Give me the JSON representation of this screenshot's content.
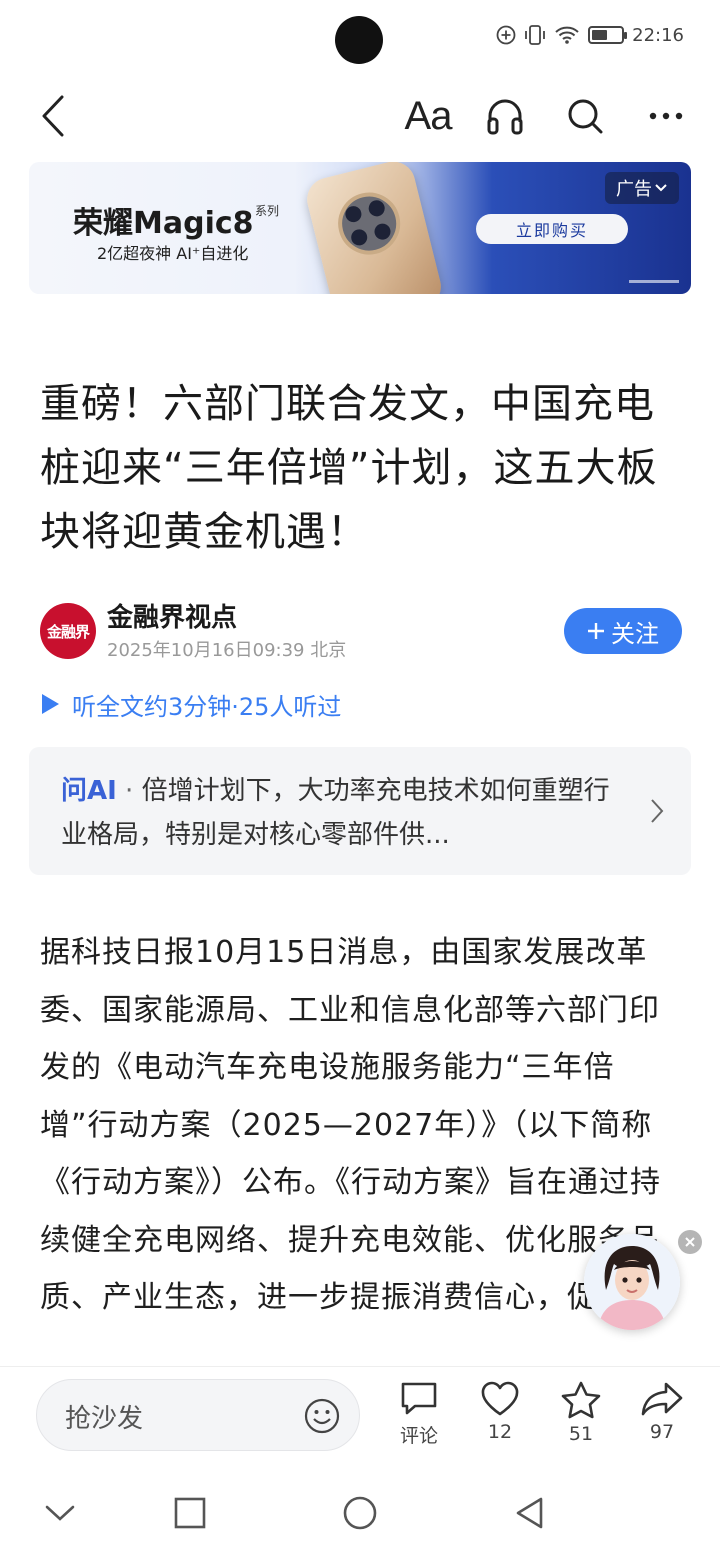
{
  "status_bar": {
    "time": "22:16",
    "battery_level_percent": 45,
    "icons": [
      "add-circle-icon",
      "vibrate-icon",
      "wifi-icon",
      "battery-icon"
    ]
  },
  "toolbar": {
    "font_label": "Aa",
    "icons": [
      "back-icon",
      "font-size-icon",
      "headphones-icon",
      "search-icon",
      "more-icon"
    ]
  },
  "ad": {
    "brand": "荣耀Magic8",
    "series": "系列",
    "slogan": "2亿超夜神  AI⁺自进化",
    "cta": "立即购买",
    "tag": "广告"
  },
  "article": {
    "headline": "重磅！六部门联合发文，中国充电桩迎来“三年倍增”计划，这五大板块将迎黄金机遇！",
    "author": {
      "avatar_text": "金融界",
      "name": "金融界视点",
      "meta": "2025年10月16日09:39 北京",
      "follow_label": "关注"
    },
    "listen_label": "听全文约3分钟·25人听过",
    "ask_ai": {
      "tag": "问AI",
      "separator": " · ",
      "text": "倍增计划下，大功率充电技术如何重塑行业格局，特别是对核心零部件供..."
    },
    "body": "据科技日报10月15日消息，由国家发展改革委、国家能源局、工业和信息化部等六部门印发的《电动汽车充电设施服务能力“三年倍增”行动方案（2025—2027年）》（以下简称《行动方案》）公布。《行动方案》旨在通过持续健全充电网络、提升充电效能、优化服务品质、产业生态，进一步提振消费信心，促进电"
  },
  "bottom_bar": {
    "comment_placeholder": "抢沙发",
    "comment_label": "评论",
    "likes": "12",
    "favorites": "51",
    "shares": "97"
  },
  "colors": {
    "accent": "#3a7ef2",
    "ai_tag": "#3a62d6",
    "brand_red": "#c8102e"
  }
}
